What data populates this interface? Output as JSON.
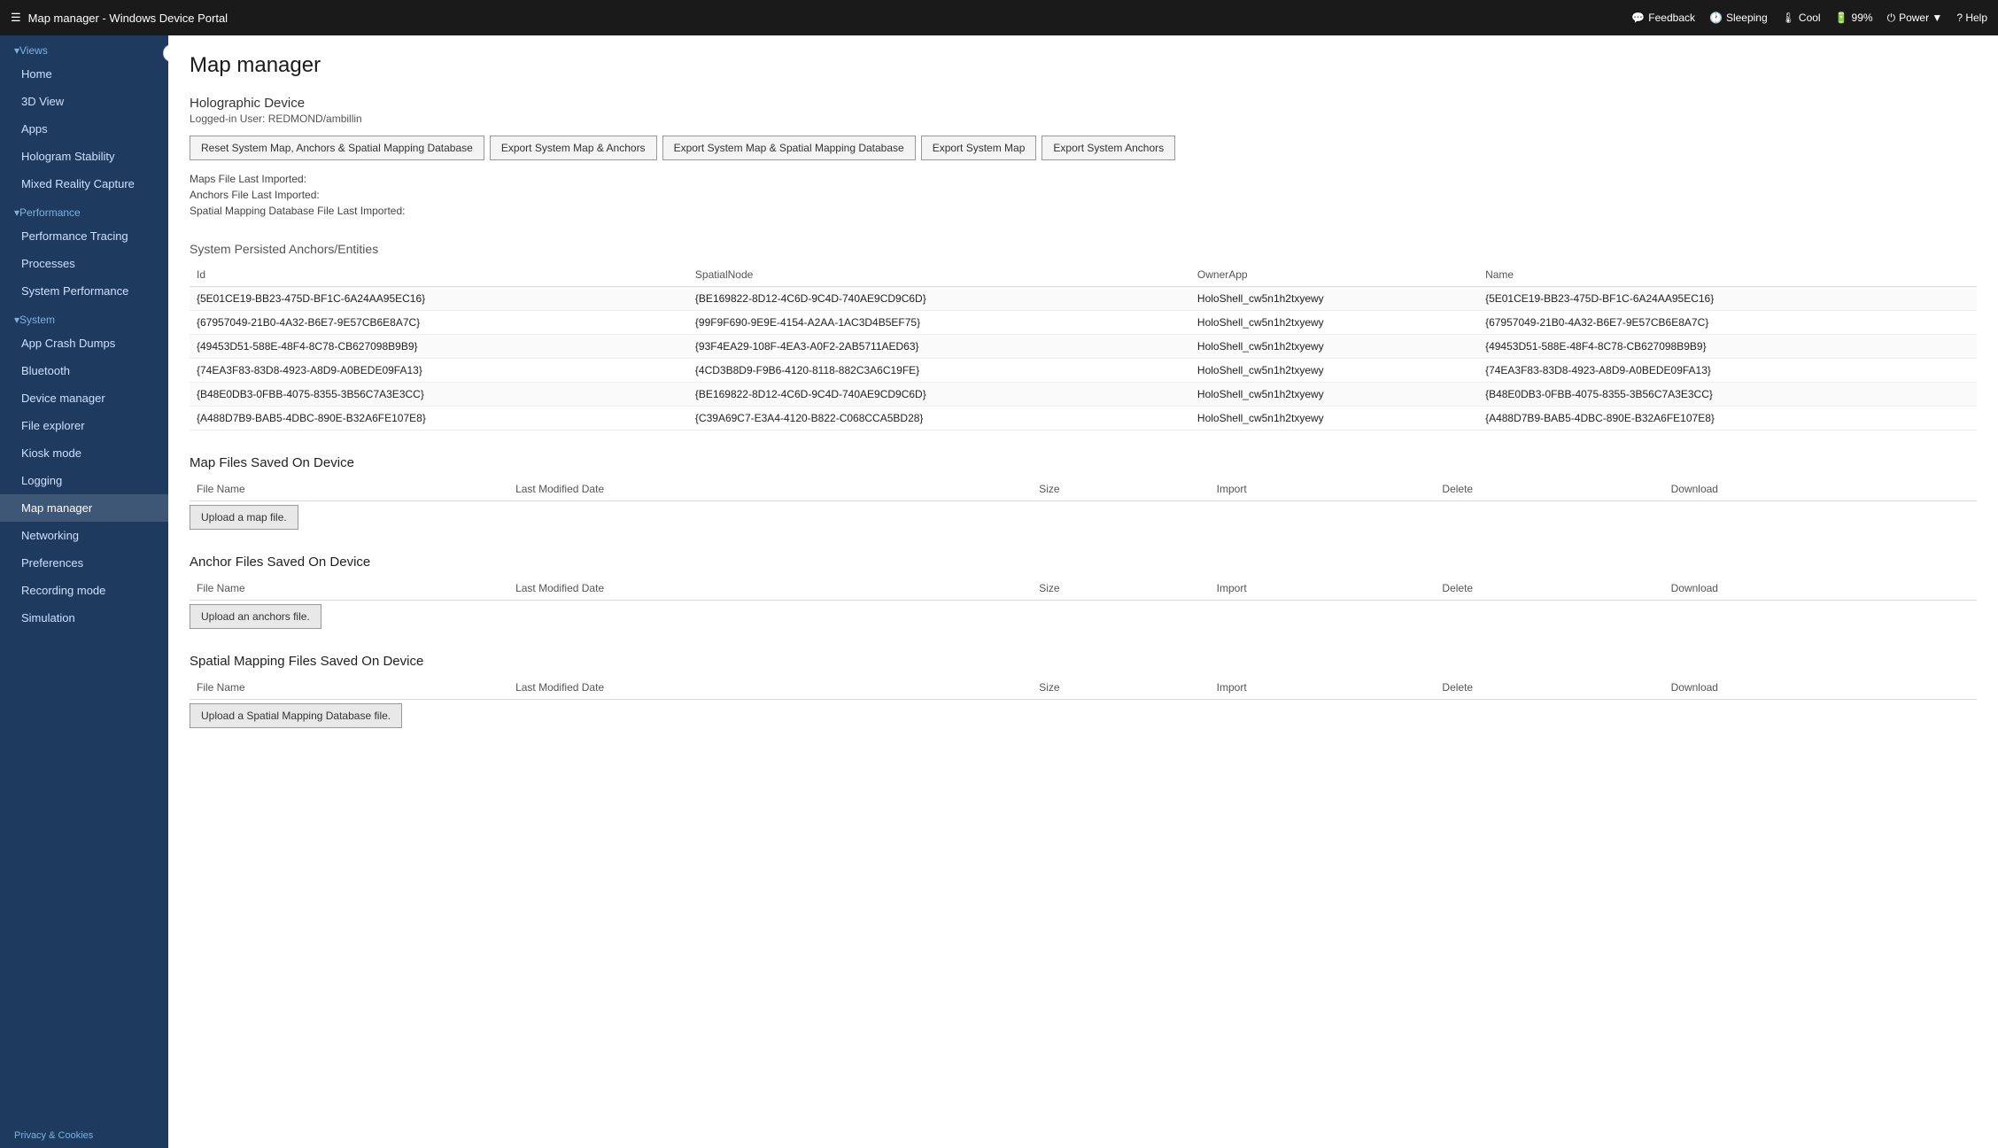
{
  "titlebar": {
    "hamburger": "☰",
    "title": "Map manager - Windows Device Portal",
    "feedback_label": "Feedback",
    "sleeping_label": "Sleeping",
    "cool_label": "Cool",
    "battery_label": "99%",
    "power_label": "Power ▼",
    "help_label": "? Help",
    "collapse_icon": "‹"
  },
  "sidebar": {
    "views_label": "▾Views",
    "performance_label": "▾Performance",
    "system_label": "▾System",
    "items_views": [
      {
        "label": "Home",
        "active": false
      },
      {
        "label": "3D View",
        "active": false
      },
      {
        "label": "Apps",
        "active": false
      },
      {
        "label": "Hologram Stability",
        "active": false
      },
      {
        "label": "Mixed Reality Capture",
        "active": false
      }
    ],
    "items_performance": [
      {
        "label": "Performance Tracing",
        "active": false
      },
      {
        "label": "Processes",
        "active": false
      },
      {
        "label": "System Performance",
        "active": false
      }
    ],
    "items_system": [
      {
        "label": "App Crash Dumps",
        "active": false
      },
      {
        "label": "Bluetooth",
        "active": false
      },
      {
        "label": "Device manager",
        "active": false
      },
      {
        "label": "File explorer",
        "active": false
      },
      {
        "label": "Kiosk mode",
        "active": false
      },
      {
        "label": "Logging",
        "active": false
      },
      {
        "label": "Map manager",
        "active": true
      },
      {
        "label": "Networking",
        "active": false
      },
      {
        "label": "Preferences",
        "active": false
      },
      {
        "label": "Recording mode",
        "active": false
      },
      {
        "label": "Simulation",
        "active": false
      }
    ],
    "privacy_label": "Privacy & Cookies"
  },
  "main": {
    "page_title": "Map manager",
    "device": {
      "name": "Holographic Device",
      "user_label": "Logged-in User: REDMOND/ambillin"
    },
    "buttons": {
      "reset": "Reset System Map, Anchors & Spatial Mapping Database",
      "export_map_anchors": "Export System Map & Anchors",
      "export_map_spatial": "Export System Map & Spatial Mapping Database",
      "export_map": "Export System Map",
      "export_anchors": "Export System Anchors"
    },
    "info_rows": [
      "Maps File Last Imported:",
      "Anchors File Last Imported:",
      "Spatial Mapping Database File Last Imported:"
    ],
    "anchors_section_title": "System Persisted Anchors/Entities",
    "anchors_columns": [
      "Id",
      "SpatialNode",
      "OwnerApp",
      "Name"
    ],
    "anchors_rows": [
      {
        "id": "{5E01CE19-BB23-475D-BF1C-6A24AA95EC16}",
        "spatial_node": "{BE169822-8D12-4C6D-9C4D-740AE9CD9C6D}",
        "owner_app": "HoloShell_cw5n1h2txyewy",
        "name": "{5E01CE19-BB23-475D-BF1C-6A24AA95EC16}"
      },
      {
        "id": "{67957049-21B0-4A32-B6E7-9E57CB6E8A7C}",
        "spatial_node": "{99F9F690-9E9E-4154-A2AA-1AC3D4B5EF75}",
        "owner_app": "HoloShell_cw5n1h2txyewy",
        "name": "{67957049-21B0-4A32-B6E7-9E57CB6E8A7C}"
      },
      {
        "id": "{49453D51-588E-48F4-8C78-CB627098B9B9}",
        "spatial_node": "{93F4EA29-108F-4EA3-A0F2-2AB5711AED63}",
        "owner_app": "HoloShell_cw5n1h2txyewy",
        "name": "{49453D51-588E-48F4-8C78-CB627098B9B9}"
      },
      {
        "id": "{74EA3F83-83D8-4923-A8D9-A0BEDE09FA13}",
        "spatial_node": "{4CD3B8D9-F9B6-4120-8118-882C3A6C19FE}",
        "owner_app": "HoloShell_cw5n1h2txyewy",
        "name": "{74EA3F83-83D8-4923-A8D9-A0BEDE09FA13}"
      },
      {
        "id": "{B48E0DB3-0FBB-4075-8355-3B56C7A3E3CC}",
        "spatial_node": "{BE169822-8D12-4C6D-9C4D-740AE9CD9C6D}",
        "owner_app": "HoloShell_cw5n1h2txyewy",
        "name": "{B48E0DB3-0FBB-4075-8355-3B56C7A3E3CC}"
      },
      {
        "id": "{A488D7B9-BAB5-4DBC-890E-B32A6FE107E8}",
        "spatial_node": "{C39A69C7-E3A4-4120-B822-C068CCA5BD28}",
        "owner_app": "HoloShell_cw5n1h2txyewy",
        "name": "{A488D7B9-BAB5-4DBC-890E-B32A6FE107E8}"
      }
    ],
    "map_files_title": "Map Files Saved On Device",
    "map_files_columns": [
      "File Name",
      "Last Modified Date",
      "Size",
      "Import",
      "Delete",
      "Download"
    ],
    "map_files_upload": "Upload a map file.",
    "anchor_files_title": "Anchor Files Saved On Device",
    "anchor_files_columns": [
      "File Name",
      "Last Modified Date",
      "Size",
      "Import",
      "Delete",
      "Download"
    ],
    "anchor_files_upload": "Upload an anchors file.",
    "spatial_files_title": "Spatial Mapping Files Saved On Device",
    "spatial_files_columns": [
      "File Name",
      "Last Modified Date",
      "Size",
      "Import",
      "Delete",
      "Download"
    ],
    "spatial_files_upload": "Upload a Spatial Mapping Database file."
  }
}
